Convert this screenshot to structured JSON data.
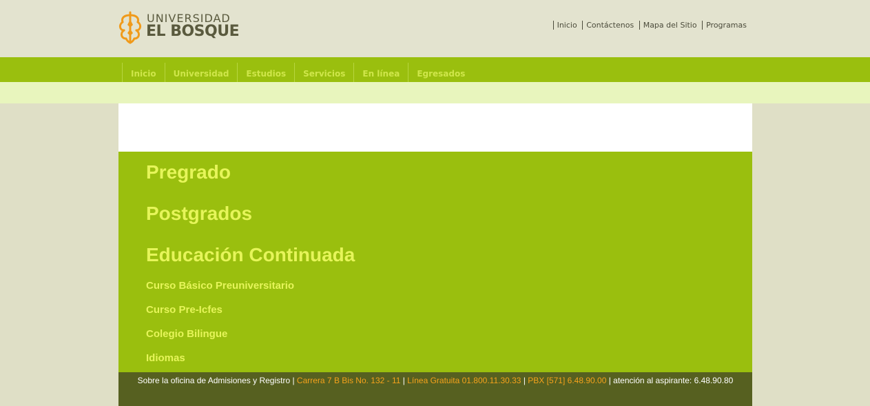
{
  "logo": {
    "line1": "UNIVERSIDAD",
    "line2": "EL BOSQUE",
    "icon": "university-emblem-icon",
    "colors": {
      "emblem": "#f09a1a",
      "text": "#5a5a3e"
    }
  },
  "top_links": [
    "Inicio",
    "Contáctenos",
    "Mapa del Sitio",
    "Programas"
  ],
  "nav": [
    "Inicio",
    "Universidad",
    "Estudios",
    "Servicios",
    "En línea",
    "Egresados"
  ],
  "programs": {
    "headings": [
      "Pregrado",
      "Postgrados",
      "Educación Continuada"
    ],
    "items": [
      "Curso Básico Preuniversitario",
      "Curso Pre-Icfes",
      "Colegio Bilingue",
      "Idiomas"
    ]
  },
  "footer": {
    "part1": "Sobre la oficina de Admisiones y Registro",
    "sep": " | ",
    "address": "Carrera 7 B Bis No. 132 - 11",
    "toll_free": "Línea Gratuita 01.800.11.30.33",
    "pbx": "PBX [571] 6.48.90.00",
    "attention": "atención al aspirante: 6.48.90.80"
  },
  "colors": {
    "background": "#dfdfc6",
    "header": "#e3e3cf",
    "nav_green": "#9abf0e",
    "nav_text": "#cfe64a",
    "subbar": "#e8f5bd",
    "panel_text": "#e6f55a",
    "footer": "#566020",
    "footer_highlight": "#f5a21b"
  }
}
